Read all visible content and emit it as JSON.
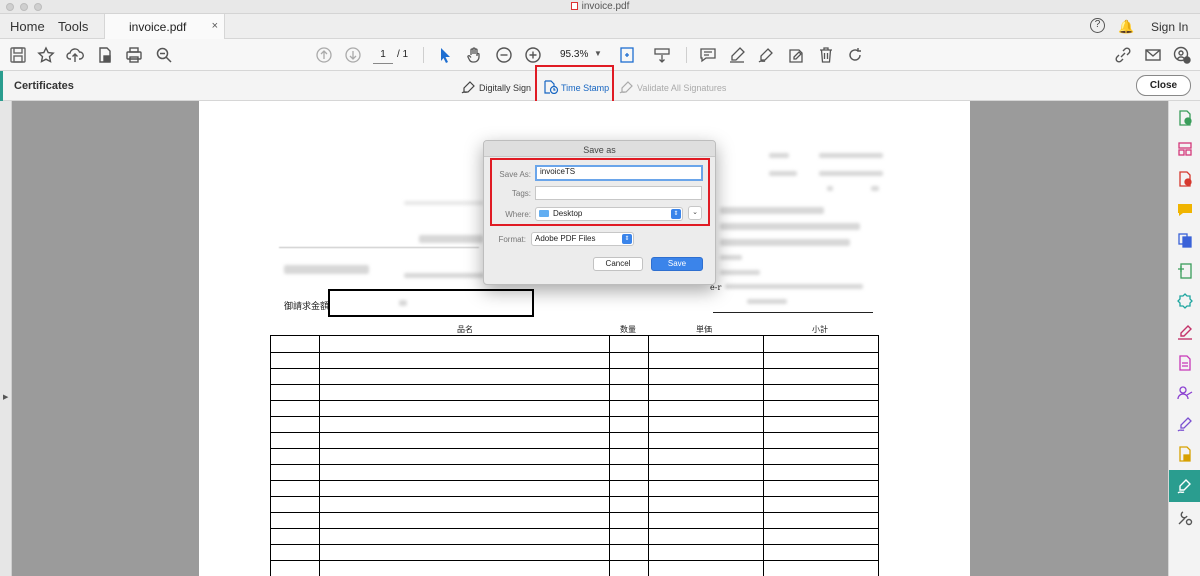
{
  "window": {
    "title": "invoice.pdf"
  },
  "nav": {
    "home": "Home",
    "tools": "Tools",
    "sign_in": "Sign In",
    "help": "?"
  },
  "document_tab": {
    "label": "invoice.pdf",
    "close": "×"
  },
  "toolbar": {
    "page_current": "1",
    "page_total": "/ 1",
    "zoom": "95.3%"
  },
  "cert_bar": {
    "title": "Certificates",
    "digitally_sign": "Digitally Sign",
    "time_stamp": "Time Stamp",
    "validate_all": "Validate All Signatures",
    "close": "Close"
  },
  "dialog": {
    "title": "Save as",
    "save_as_label": "Save As:",
    "save_as_value": "invoiceTS",
    "tags_label": "Tags:",
    "tags_value": "",
    "where_label": "Where:",
    "where_value": "Desktop",
    "format_label": "Format:",
    "format_value": "Adobe PDF Files",
    "cancel": "Cancel",
    "save": "Save"
  },
  "invoice": {
    "amount_label": "御請求金額",
    "e_label": "e-r",
    "columns": [
      "品名",
      "数量",
      "単価",
      "小計"
    ]
  },
  "colors": {
    "accent": "#2a9d8f",
    "highlight": "#e01b24",
    "primary_button": "#3b84ea"
  }
}
